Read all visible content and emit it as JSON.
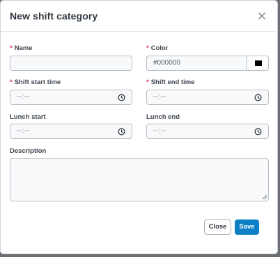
{
  "modal": {
    "title": "New shift category",
    "close_icon": "close-icon"
  },
  "form": {
    "name": {
      "label": "Name",
      "required": "*",
      "value": ""
    },
    "color": {
      "label": "Color",
      "required": "*",
      "value": "#000000",
      "swatch_color": "#000000"
    },
    "shift_start": {
      "label": "Shift start time",
      "required": "*",
      "value": "--:--"
    },
    "shift_end": {
      "label": "Shift end time",
      "required": "*",
      "value": "--:--"
    },
    "lunch_start": {
      "label": "Lunch start",
      "value": "--:--"
    },
    "lunch_end": {
      "label": "Lunch end",
      "value": "--:--"
    },
    "description": {
      "label": "Description",
      "value": ""
    }
  },
  "footer": {
    "close_label": "Close",
    "save_label": "Save"
  },
  "colors": {
    "accent": "#0d7fc4",
    "required": "#dc3545"
  }
}
